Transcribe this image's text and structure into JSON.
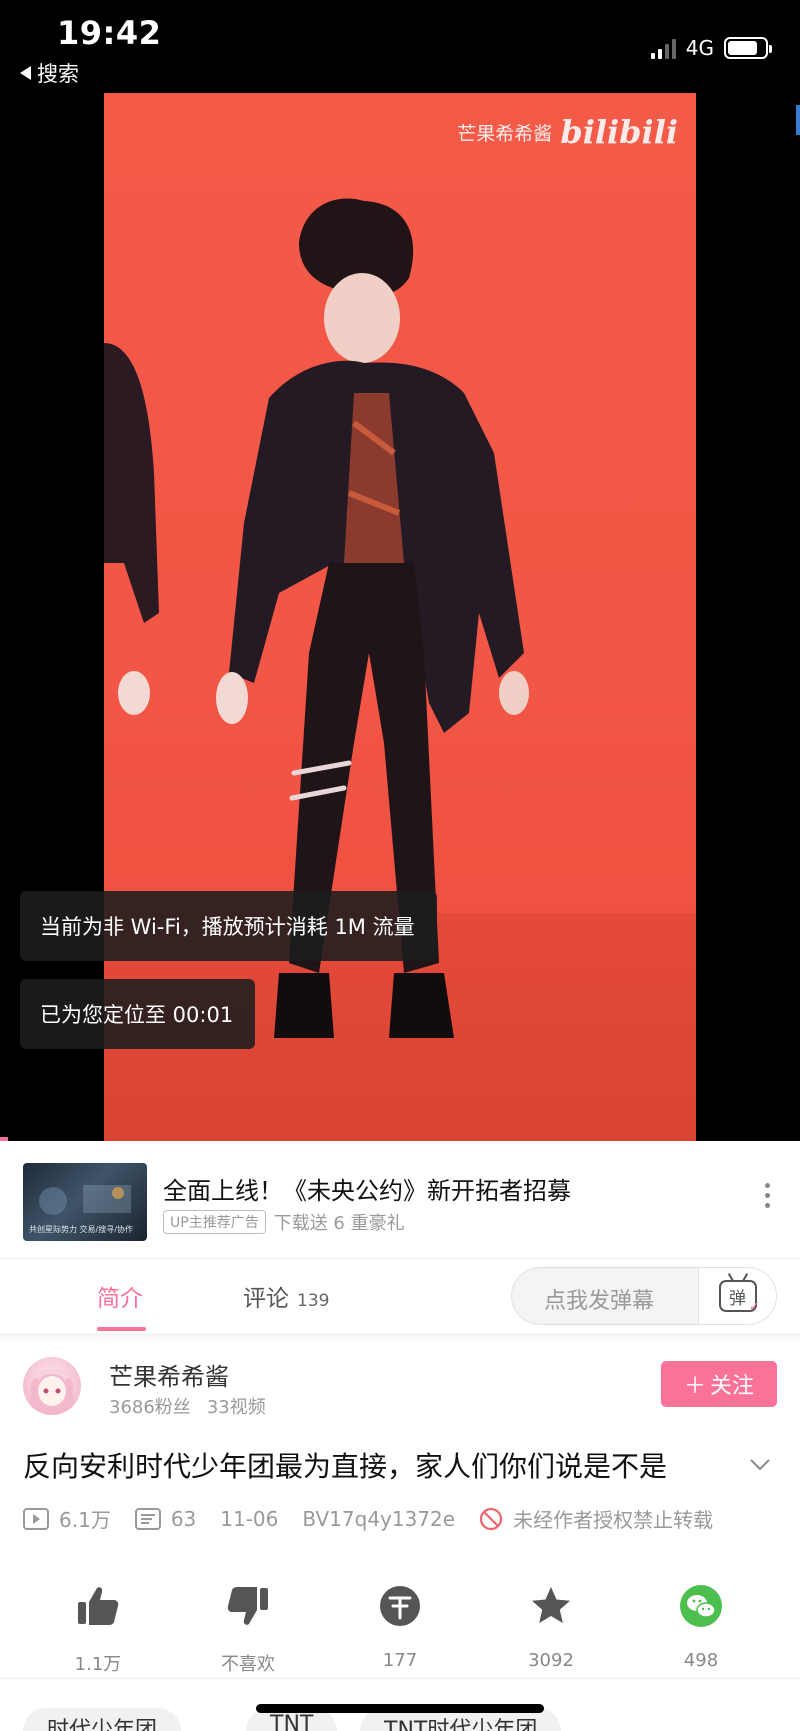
{
  "status": {
    "time": "19:42",
    "back_label": "搜索",
    "network": "4G",
    "battery_level": 0.8
  },
  "video": {
    "watermark_user": "芒果希希酱",
    "watermark_logo": "bilibili",
    "toast_network": "当前为非 Wi-Fi，播放预计消耗 1M 流量",
    "toast_position": "已为您定位至 00:01"
  },
  "ad": {
    "thumb_caption": "共创星际势力  交易/搜寻/协作",
    "title": "全面上线！《未央公约》新开拓者招募",
    "tag": "UP主推荐广告",
    "desc": "下载送 6 重豪礼"
  },
  "tabs": {
    "intro": "简介",
    "comments": "评论",
    "comments_count": "139",
    "danmaku_placeholder": "点我发弹幕",
    "danmaku_icon_char": "弹"
  },
  "uploader": {
    "name": "芒果希希酱",
    "fans": "3686粉丝",
    "videos": "33视频",
    "follow_label": "关注"
  },
  "video_info": {
    "title": "反向安利时代少年团最为直接，家人们你们说是不是",
    "views": "6.1万",
    "danmaku_count": "63",
    "date": "11-06",
    "bvid": "BV17q4y1372e",
    "copyright": "未经作者授权禁止转载"
  },
  "actions": {
    "like": "1.1万",
    "dislike": "不喜欢",
    "coin": "177",
    "favorite": "3092",
    "share": "498"
  },
  "tags": [
    "时代少年团",
    "TNT",
    "TNT时代少年团"
  ],
  "colors": {
    "accent": "#fb7299",
    "video_bg": "#f35a48",
    "share_green": "#4cbf4e",
    "icon_gray": "#555555"
  }
}
